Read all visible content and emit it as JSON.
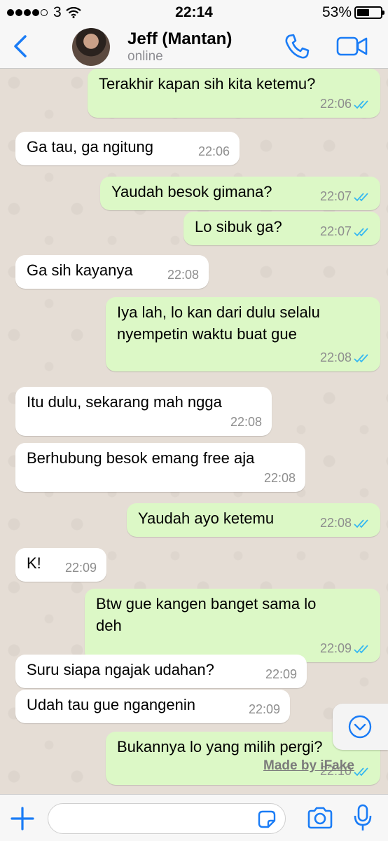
{
  "status_bar": {
    "carrier": "3",
    "time": "22:14",
    "battery": "53%",
    "battery_level": 0.53
  },
  "header": {
    "contact_name": "Jeff (Mantan)",
    "contact_status": "online",
    "back_icon": "chevron-left-icon",
    "call_icon": "phone-icon",
    "video_icon": "video-camera-icon"
  },
  "messages": [
    {
      "dir": "out",
      "text": "Terakhir kapan sih kita ketemu?",
      "time": "22:06",
      "read": true
    },
    {
      "dir": "in",
      "text": "Ga tau, ga ngitung",
      "time": "22:06"
    },
    {
      "dir": "out",
      "text": "Yaudah besok gimana?",
      "time": "22:07",
      "read": true
    },
    {
      "dir": "out",
      "text": "Lo sibuk ga?",
      "time": "22:07",
      "read": true
    },
    {
      "dir": "in",
      "text": "Ga sih kayanya",
      "time": "22:08"
    },
    {
      "dir": "out",
      "lines": [
        "Iya lah, lo kan dari dulu selalu",
        "nyempetin waktu buat gue"
      ],
      "time": "22:08",
      "read": true
    },
    {
      "dir": "in",
      "text": "Itu dulu, sekarang mah ngga",
      "time": "22:08"
    },
    {
      "dir": "in",
      "text": "Berhubung besok emang free aja",
      "time": "22:08"
    },
    {
      "dir": "out",
      "text": "Yaudah ayo ketemu",
      "time": "22:08",
      "read": true
    },
    {
      "dir": "in",
      "text": "K!",
      "time": "22:09"
    },
    {
      "dir": "out",
      "lines": [
        "Btw gue kangen banget sama lo",
        "deh"
      ],
      "time": "22:09",
      "read": true
    },
    {
      "dir": "in",
      "text": "Suru siapa ngajak udahan?",
      "time": "22:09"
    },
    {
      "dir": "in",
      "text": "Udah tau gue ngangenin",
      "time": "22:09"
    },
    {
      "dir": "out",
      "text": "Bukannya lo yang milih pergi?",
      "time": "22:10",
      "read": true
    }
  ],
  "watermark": "Made by iFake",
  "input": {
    "placeholder": ""
  },
  "colors": {
    "accent": "#1a7cf6",
    "outgoing_bubble": "#dcf8c6",
    "incoming_bubble": "#ffffff",
    "read_ticks": "#34b7f1",
    "chat_background": "#e5ddd5"
  }
}
